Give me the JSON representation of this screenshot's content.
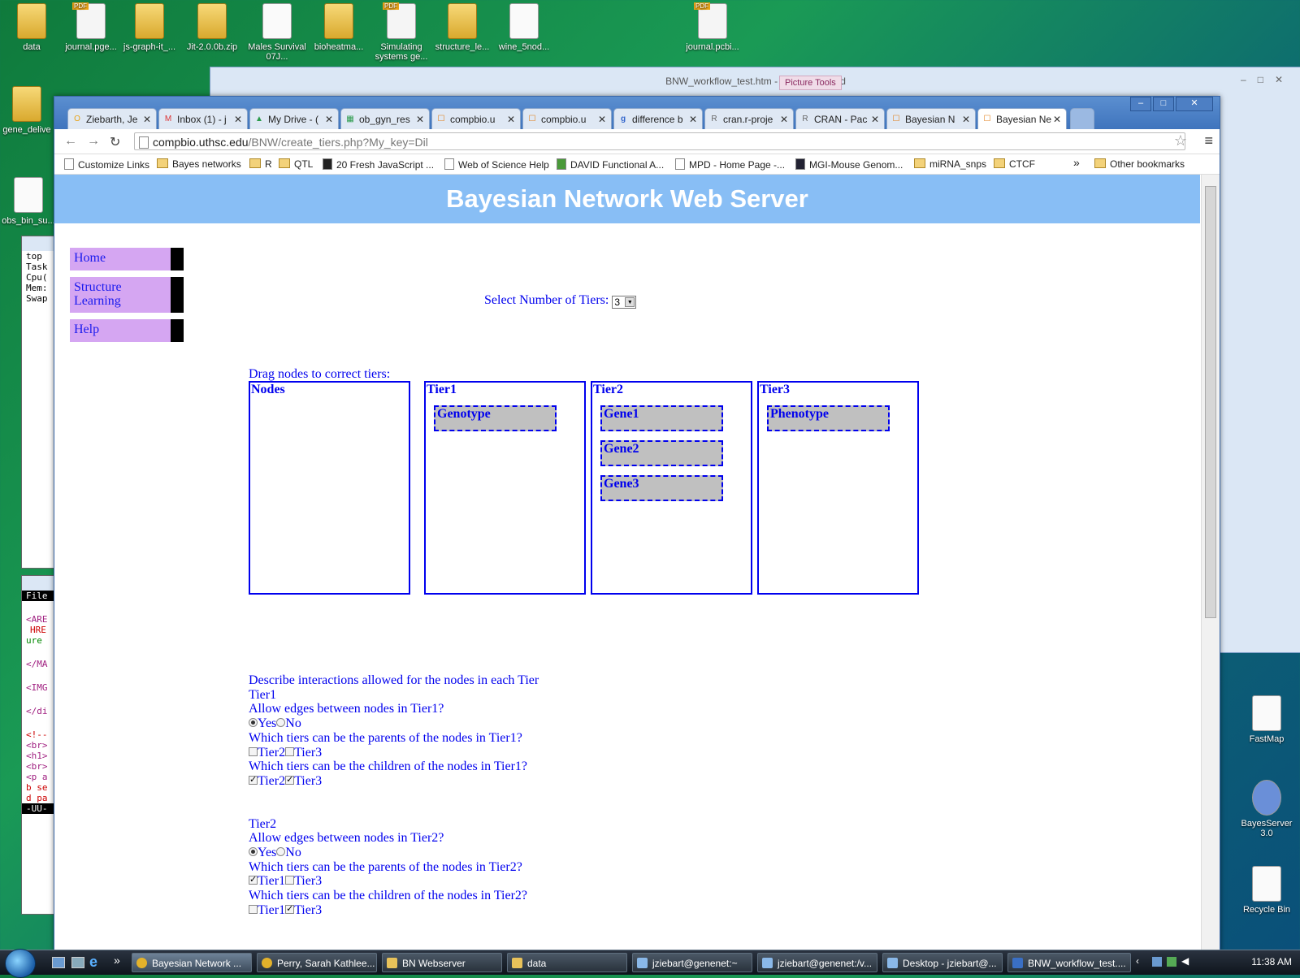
{
  "desktop_icons": [
    {
      "label": "data",
      "type": "folder"
    },
    {
      "label": "journal.pge...",
      "type": "pdf"
    },
    {
      "label": "js-graph-it_...",
      "type": "folder"
    },
    {
      "label": "Jit-2.0.0b.zip",
      "type": "folder"
    },
    {
      "label": "Males Survival 07J...",
      "type": "doc"
    },
    {
      "label": "bioheatma...",
      "type": "folder"
    },
    {
      "label": "Simulating systems ge...",
      "type": "pdf"
    },
    {
      "label": "structure_le...",
      "type": "folder"
    },
    {
      "label": "wine_5nod...",
      "type": "doc"
    },
    {
      "label": "journal.pcbi...",
      "type": "pdf"
    },
    {
      "label": "gene_delive",
      "type": "folder"
    },
    {
      "label": "obs_bin_su...",
      "type": "doc"
    },
    {
      "label": "FastMap",
      "type": "doc"
    },
    {
      "label": "BayesServer 3.0",
      "type": "doc"
    },
    {
      "label": "Recycle Bin",
      "type": "doc"
    }
  ],
  "word": {
    "title": "BNW_workflow_test.htm - Microsoft Word",
    "picture_tools": "Picture Tools"
  },
  "chrome": {
    "tabs": [
      {
        "label": "Ziebarth, Je",
        "fav": "O"
      },
      {
        "label": "Inbox (1) - j",
        "fav": "M"
      },
      {
        "label": "My Drive - (",
        "fav": "▲"
      },
      {
        "label": "ob_gyn_res",
        "fav": "▦"
      },
      {
        "label": "compbio.u",
        "fav": "☐"
      },
      {
        "label": "compbio.u",
        "fav": "☐"
      },
      {
        "label": "difference b",
        "fav": "g"
      },
      {
        "label": "cran.r-proje",
        "fav": "R"
      },
      {
        "label": "CRAN - Pac",
        "fav": "R"
      },
      {
        "label": "Bayesian N",
        "fav": "☐"
      },
      {
        "label": "Bayesian Ne",
        "fav": "☐"
      }
    ],
    "url_host": "compbio.uthsc.edu",
    "url_path": "/BNW/create_tiers.php?My_key=Dil",
    "bookmarks": [
      {
        "label": "Customize Links",
        "kind": "page"
      },
      {
        "label": "Bayes networks",
        "kind": "folder"
      },
      {
        "label": "R",
        "kind": "folder"
      },
      {
        "label": "QTL",
        "kind": "folder"
      },
      {
        "label": "20 Fresh JavaScript ...",
        "kind": "page"
      },
      {
        "label": "Web of Science Help",
        "kind": "page"
      },
      {
        "label": "DAVID Functional A...",
        "kind": "page"
      },
      {
        "label": "MPD - Home Page -...",
        "kind": "page"
      },
      {
        "label": "MGI-Mouse Genom...",
        "kind": "page"
      },
      {
        "label": "miRNA_snps",
        "kind": "folder"
      },
      {
        "label": "CTCF",
        "kind": "folder"
      }
    ],
    "bookmarks_more": "»",
    "other_bookmarks": "Other bookmarks"
  },
  "page": {
    "banner": "Bayesian Network Web Server",
    "nav": [
      "Home",
      "Structure Learning",
      "Help"
    ],
    "select_label": "Select Number of Tiers:",
    "select_value": "3",
    "drag_label": "Drag nodes to correct tiers:",
    "columns": [
      {
        "header": "Nodes",
        "nodes": []
      },
      {
        "header": "Tier1",
        "nodes": [
          "Genotype"
        ]
      },
      {
        "header": "Tier2",
        "nodes": [
          "Gene1",
          "Gene2",
          "Gene3"
        ]
      },
      {
        "header": "Tier3",
        "nodes": [
          "Phenotype"
        ]
      }
    ],
    "describe_heading": "Describe interactions allowed for the nodes in each Tier",
    "yes": "Yes",
    "no": "No",
    "tier1": {
      "title": "Tier1",
      "q_edges": "Allow edges between nodes in Tier1?",
      "q_parents": "Which tiers can be the parents of the nodes in Tier1?",
      "parents": [
        {
          "label": "Tier2",
          "checked": false
        },
        {
          "label": "Tier3",
          "checked": false
        }
      ],
      "q_children": "Which tiers can be the children of the nodes in Tier1?",
      "children": [
        {
          "label": "Tier2",
          "checked": true
        },
        {
          "label": "Tier3",
          "checked": true
        }
      ]
    },
    "tier2": {
      "title": "Tier2",
      "q_edges": "Allow edges between nodes in Tier2?",
      "q_parents": "Which tiers can be the parents of the nodes in Tier2?",
      "parents": [
        {
          "label": "Tier1",
          "checked": true
        },
        {
          "label": "Tier3",
          "checked": false
        }
      ],
      "q_children": "Which tiers can be the children of the nodes in Tier2?",
      "children": [
        {
          "label": "Tier1",
          "checked": false
        },
        {
          "label": "Tier3",
          "checked": true
        }
      ]
    }
  },
  "terminal_lines": [
    "top",
    "Task",
    "Cpu(",
    "Mem:",
    "Swap"
  ],
  "terminal2_lines": [
    "File",
    "<ARE",
    "HRE",
    "ure",
    "</MA",
    "<IMG",
    "</di",
    "<!--",
    "<br>",
    "<h1>",
    "<br>",
    "<p a",
    "b se",
    "d pa",
    "-UU-"
  ],
  "taskbar": {
    "items": [
      "Bayesian Network ...",
      "Perry, Sarah Kathlee...",
      "BN Webserver",
      "data",
      "jziebart@genenet:~",
      "jziebart@genenet:/v...",
      "Desktop - jziebart@...",
      "BNW_workflow_test...."
    ],
    "clock": "11:38 AM"
  }
}
